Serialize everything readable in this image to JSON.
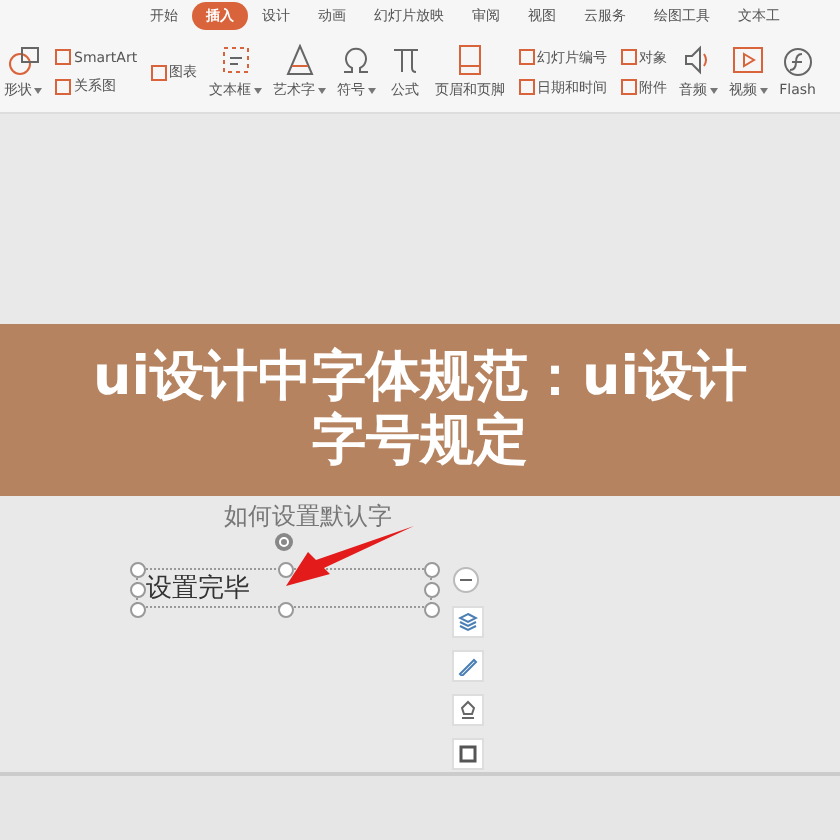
{
  "tabs": [
    {
      "label": "开始",
      "selected": false
    },
    {
      "label": "插入",
      "selected": true
    },
    {
      "label": "设计",
      "selected": false
    },
    {
      "label": "动画",
      "selected": false
    },
    {
      "label": "幻灯片放映",
      "selected": false
    },
    {
      "label": "审阅",
      "selected": false
    },
    {
      "label": "视图",
      "selected": false
    },
    {
      "label": "云服务",
      "selected": false
    },
    {
      "label": "绘图工具",
      "selected": false
    },
    {
      "label": "文本工",
      "selected": false
    }
  ],
  "ribbon": [
    {
      "kind": "big",
      "label": "形状",
      "dropdown": true
    },
    {
      "kind": "pair",
      "items": [
        {
          "label": "SmartArt"
        },
        {
          "label": "关系图"
        }
      ]
    },
    {
      "kind": "pair",
      "items": [
        {
          "label": "图表"
        }
      ]
    },
    {
      "kind": "big",
      "label": "文本框",
      "dropdown": true
    },
    {
      "kind": "big",
      "label": "艺术字",
      "dropdown": true
    },
    {
      "kind": "big",
      "label": "符号",
      "dropdown": true
    },
    {
      "kind": "big",
      "label": "公式",
      "dropdown": false
    },
    {
      "kind": "big",
      "label": "页眉和页脚",
      "dropdown": false
    },
    {
      "kind": "pair",
      "items": [
        {
          "label": "幻灯片编号"
        },
        {
          "label": "日期和时间"
        }
      ]
    },
    {
      "kind": "pair",
      "items": [
        {
          "label": "对象"
        },
        {
          "label": "附件"
        }
      ]
    },
    {
      "kind": "big",
      "label": "音频",
      "dropdown": true
    },
    {
      "kind": "big",
      "label": "视频",
      "dropdown": true
    },
    {
      "kind": "big",
      "label": "Flash",
      "dropdown": false
    }
  ],
  "slide": {
    "heading": "如何设置默认字",
    "textbox": "设置完毕"
  },
  "banner": {
    "title": "ui设计中字体规范：ui设计字号规定"
  }
}
